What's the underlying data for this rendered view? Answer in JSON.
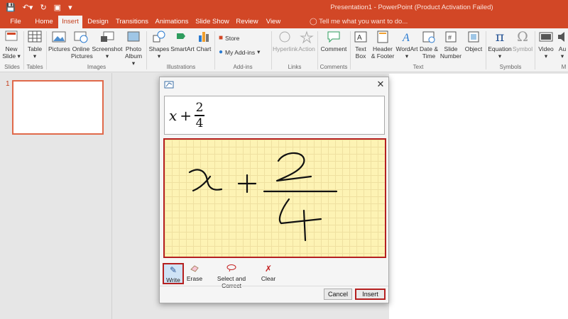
{
  "window": {
    "title": "Presentation1 - PowerPoint (Product Activation Failed)"
  },
  "tabs": [
    "File",
    "Home",
    "Insert",
    "Design",
    "Transitions",
    "Animations",
    "Slide Show",
    "Review",
    "View"
  ],
  "tell_me": "Tell me what you want to do...",
  "ribbon": {
    "slides": {
      "new_slide": "New",
      "new_slide2": "Slide",
      "group": "Slides"
    },
    "tables": {
      "table": "Table",
      "group": "Tables"
    },
    "images": {
      "pictures": "Pictures",
      "online": "Online",
      "online2": "Pictures",
      "screenshot": "Screenshot",
      "photo": "Photo",
      "photo2": "Album",
      "group": "Images"
    },
    "illustrations": {
      "shapes": "Shapes",
      "smartart": "SmartArt",
      "chart": "Chart",
      "group": "Illustrations"
    },
    "addins": {
      "store": "Store",
      "my_addins": "My Add-ins",
      "group": "Add-ins"
    },
    "links": {
      "hyperlink": "Hyperlink",
      "action": "Action",
      "group": "Links"
    },
    "comments": {
      "comment": "Comment",
      "group": "Comments"
    },
    "text": {
      "textbox": "Text",
      "textbox2": "Box",
      "header": "Header",
      "header2": "& Footer",
      "wordart": "WordArt",
      "datetime": "Date &",
      "datetime2": "Time",
      "slidenum": "Slide",
      "slidenum2": "Number",
      "object": "Object",
      "group": "Text"
    },
    "symbols": {
      "equation": "Equation",
      "symbol": "Symbol",
      "group": "Symbols"
    },
    "media": {
      "video": "Video",
      "audio": "Au",
      "group": "M"
    }
  },
  "slide_pane": {
    "number": "1"
  },
  "dialog": {
    "preview": {
      "var": "x",
      "op": "+",
      "numerator": "2",
      "denominator": "4"
    },
    "tools": [
      "Write",
      "Erase",
      "Select and Correct",
      "Clear"
    ],
    "cancel": "Cancel",
    "insert": "Insert"
  },
  "colors": {
    "accent": "#d24726",
    "highlight": "#b52020",
    "canvas": "#fdf3b4"
  }
}
